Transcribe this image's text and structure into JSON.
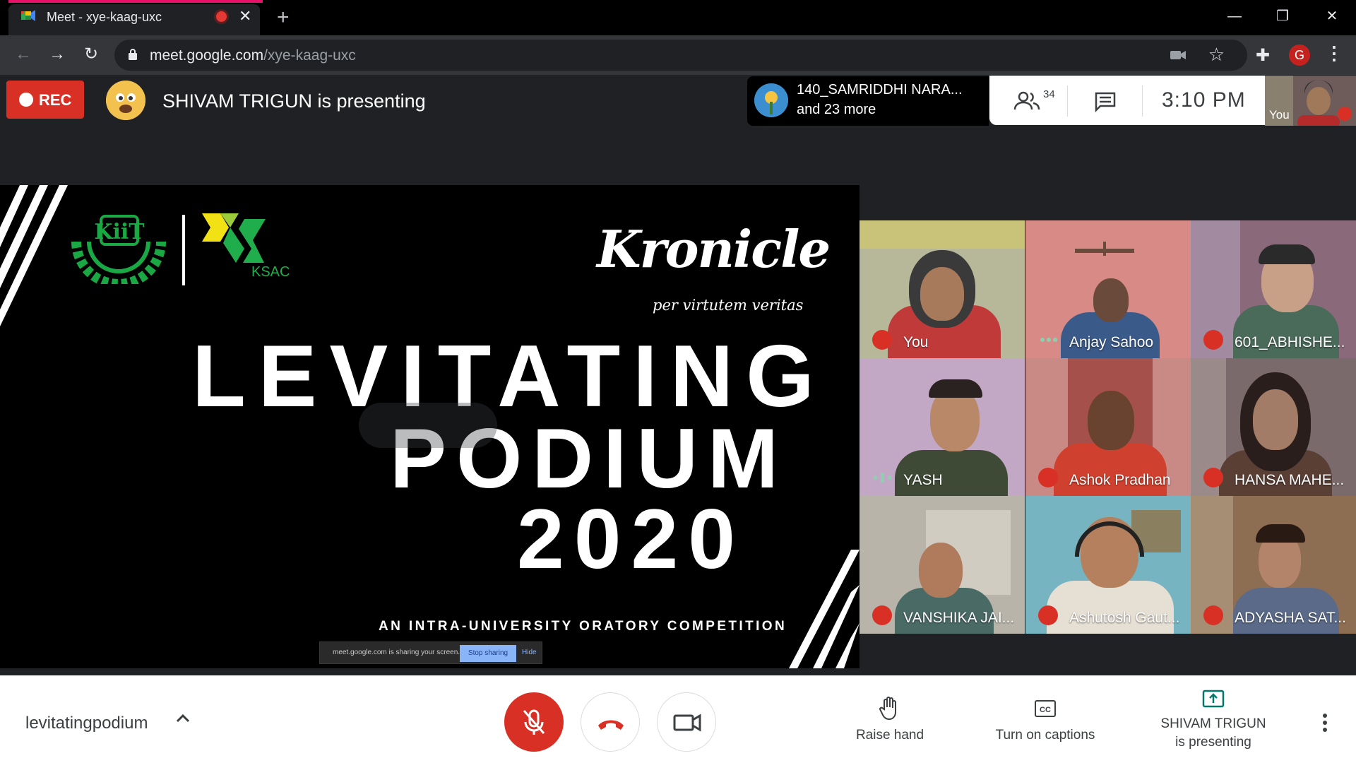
{
  "browser": {
    "tab_title": "Meet - xye-kaag-uxc",
    "url_domain": "meet.google.com",
    "url_path": "/xye-kaag-uxc",
    "profile_initial": "G"
  },
  "meet_top": {
    "rec_label": "REC",
    "presenting_text": "SHIVAM TRIGUN is presenting",
    "chip_name": "140_SAMRIDDHI NARA...",
    "chip_more": "and 23 more",
    "people_count": "34",
    "clock": "3:10  PM",
    "self_label": "You"
  },
  "presentation": {
    "kronicle": "Kronicle",
    "kronicle_tag": "per virtutem veritas",
    "ksac": "KSAC",
    "title_line1": "LEVITATING",
    "title_line2": "PODIUM",
    "title_line3": "2020",
    "subtitle": "AN INTRA-UNIVERSITY ORATORY COMPETITION",
    "share_text": "meet.google.com is sharing your screen.",
    "share_stop": "Stop sharing",
    "share_hide": "Hide"
  },
  "tiles": [
    {
      "name": "You",
      "status": "muted"
    },
    {
      "name": "Anjay Sahoo",
      "status": "idle"
    },
    {
      "name": "601_ABHISHE...",
      "status": "muted"
    },
    {
      "name": "YASH",
      "status": "speaking"
    },
    {
      "name": "Ashok Pradhan",
      "status": "muted"
    },
    {
      "name": "HANSA MAHE...",
      "status": "muted"
    },
    {
      "name": "VANSHIKA JAI...",
      "status": "muted"
    },
    {
      "name": "Ashutosh Gaut...",
      "status": "muted"
    },
    {
      "name": "ADYASHA SAT...",
      "status": "muted"
    }
  ],
  "bottom": {
    "meeting_name": "levitatingpodium",
    "raise_hand": "Raise hand",
    "captions": "Turn on captions",
    "present_line1": "SHIVAM TRIGUN",
    "present_line2": "is presenting"
  },
  "colors": {
    "danger": "#d93025",
    "accent": "#e8116a",
    "green": "#1fae4b",
    "present_teal": "#00796b"
  }
}
